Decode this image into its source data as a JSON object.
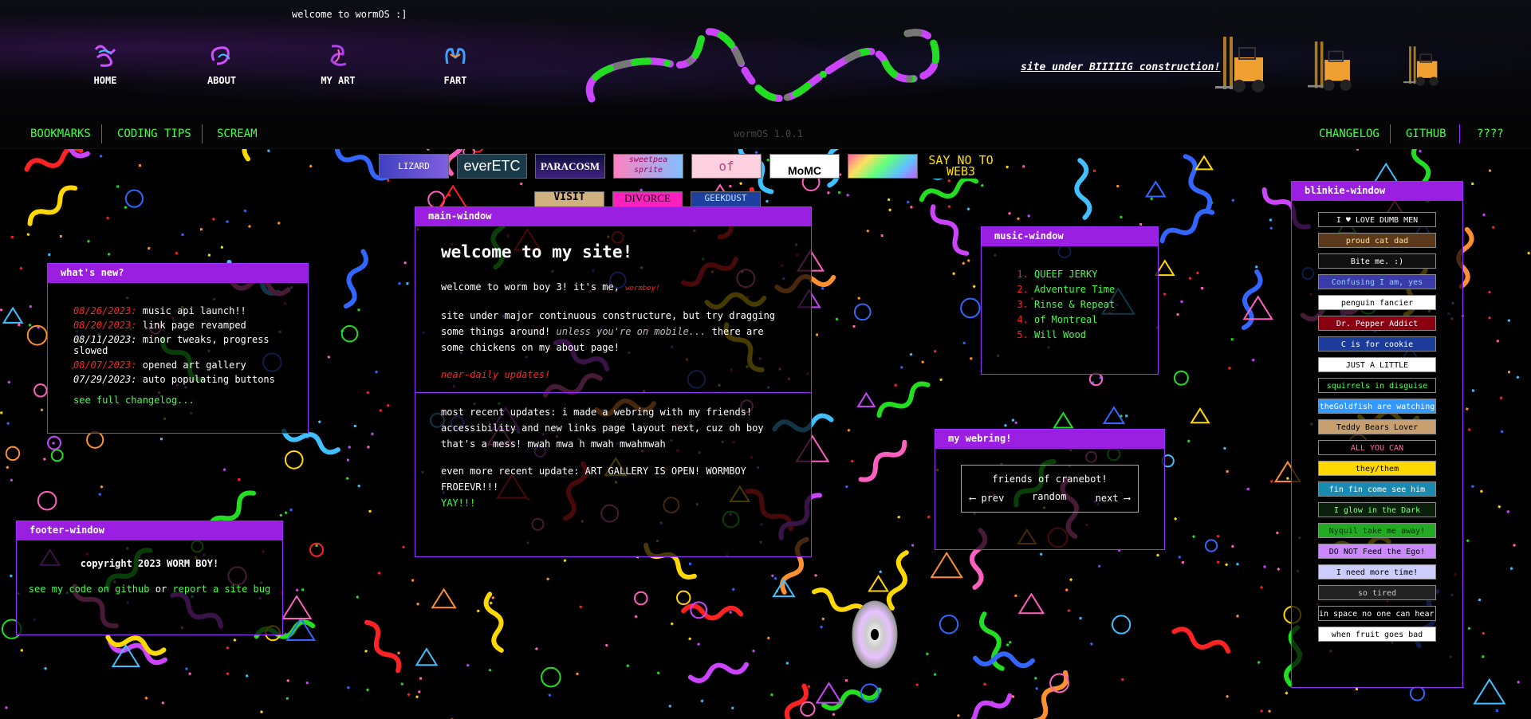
{
  "header": {
    "greeting": "welcome to wormOS :]",
    "nav": [
      {
        "label": "HOME",
        "icon": "worm-squiggle-icon"
      },
      {
        "label": "ABOUT",
        "icon": "worm-loop-icon"
      },
      {
        "label": "MY ART",
        "icon": "worm-paint-icon"
      },
      {
        "label": "FART",
        "icon": "worm-blob-icon"
      }
    ],
    "construction_text": "site under BIIIIIG construction!",
    "colors": {
      "worm_purple": "#cc44ff",
      "worm_green": "#22dd22",
      "worm_gray": "#777777"
    }
  },
  "linkbar": {
    "left": [
      "BOOKMARKS",
      "CODING TIPS",
      "SCREAM"
    ],
    "version": "wormOS 1.0.1",
    "right": [
      "CHANGELOG",
      "GITHUB",
      "????"
    ]
  },
  "banners": {
    "row1": [
      "LIZARD",
      "everETC",
      "PARACOSM",
      "sweetpea sprite",
      "of",
      "MoMC",
      "",
      "SAY NO TO WEB3"
    ],
    "row2": [
      "VISIT",
      "DIVORCE",
      "GEEKDUST"
    ]
  },
  "whats_new": {
    "title": "what's new?",
    "items": [
      {
        "date": "08/26/2023:",
        "text": "music api launch!!",
        "date_color": "#ff2222"
      },
      {
        "date": "08/20/2023:",
        "text": "link page revamped",
        "date_color": "#ff2222"
      },
      {
        "date": "08/11/2023:",
        "text": "minor tweaks, progress slowed",
        "date_color": "#ffffff"
      },
      {
        "date": "08/07/2023:",
        "text": "opened art gallery",
        "date_color": "#ff2222"
      },
      {
        "date": "07/29/2023:",
        "text": "auto populating buttons",
        "date_color": "#ffffff"
      }
    ],
    "changelog_link": "see full changelog..."
  },
  "footer_window": {
    "title": "footer-window",
    "copyright": "copyright 2023 WORM BOY!",
    "code_link": "see my code on github",
    "or_text": "or",
    "bug_link": "report a site bug"
  },
  "main_window": {
    "title": "main-window",
    "heading": "welcome to my site!",
    "intro": "welcome to worm boy 3! it's me,",
    "intro_sig": "wormboy!",
    "p2_a": "site under major continuous constructure, but try dragging some things around!",
    "p2_b": "unless you're on mobile...",
    "p2_c": "there are some chickens on my about page!",
    "near_daily": "near-daily updates!",
    "p3": "most recent updates: i made a webring with my friends! accessibility and new links page layout next, cuz oh boy that's a mess! mwah mwa h mwah mwahmwah",
    "p4_a": "even more recent update: ART GALLERY IS OPEN! WORMBOY FROEEVR!!!",
    "p4_b": "YAY!!!"
  },
  "music_window": {
    "title": "music-window",
    "tracks": [
      "QUEEF JERKY",
      "Adventure Time",
      "Rinse & Repeat",
      "of Montreal",
      "Will Wood"
    ]
  },
  "webring": {
    "title": "my webring!",
    "name": "friends of cranebot!",
    "prev": "⟵ prev",
    "random": "random",
    "next": "next ⟶"
  },
  "blinkie_window": {
    "title": "blinkie-window",
    "items": [
      {
        "text": "I ♥ LOVE DUMB MEN",
        "bg": "#000000",
        "fg": "#ffffff"
      },
      {
        "text": "proud cat dad",
        "bg": "#5a3a1a",
        "fg": "#ffe0a0"
      },
      {
        "text": "Bite me. :)",
        "bg": "#111111",
        "fg": "#ffffff"
      },
      {
        "text": "Confusing I am, yes",
        "bg": "#3a3aa8",
        "fg": "#99ccff"
      },
      {
        "text": "penguin fancier",
        "bg": "#ffffff",
        "fg": "#000000"
      },
      {
        "text": "Dr. Pepper Addict",
        "bg": "#8a0010",
        "fg": "#ffffff"
      },
      {
        "text": "C is for cookie",
        "bg": "#1c3c9c",
        "fg": "#ffffff"
      },
      {
        "text": "JUST A LITTLE",
        "bg": "#ffffff",
        "fg": "#000000"
      },
      {
        "text": "squirrels in disguise",
        "bg": "#000000",
        "fg": "#44ff44"
      },
      {
        "text": "theGoldfish are watching",
        "bg": "#3399ff",
        "fg": "#ffffff"
      },
      {
        "text": "Teddy Bears Lover",
        "bg": "#c8a070",
        "fg": "#000000"
      },
      {
        "text": "ALL YOU CAN",
        "bg": "#000000",
        "fg": "#ff66aa"
      },
      {
        "text": "they/them",
        "bg": "#ffd800",
        "fg": "#000000"
      },
      {
        "text": "fin fin come see him",
        "bg": "#1a8ab0",
        "fg": "#ffffff"
      },
      {
        "text": "I glow in the Dark",
        "bg": "#0a200a",
        "fg": "#88ff88"
      },
      {
        "text": "Nyquil take me away!",
        "bg": "#22aa22",
        "fg": "#003300"
      },
      {
        "text": "DO NOT Feed the Ego!",
        "bg": "#cc88ff",
        "fg": "#000000"
      },
      {
        "text": "I need more time!",
        "bg": "#ccccff",
        "fg": "#000000"
      },
      {
        "text": "so tired",
        "bg": "#222222",
        "fg": "#cccccc"
      },
      {
        "text": "in space no one can hear you moo",
        "bg": "#000000",
        "fg": "#ffffff"
      },
      {
        "text": "when fruit goes bad",
        "bg": "#ffffff",
        "fg": "#000000"
      }
    ]
  }
}
